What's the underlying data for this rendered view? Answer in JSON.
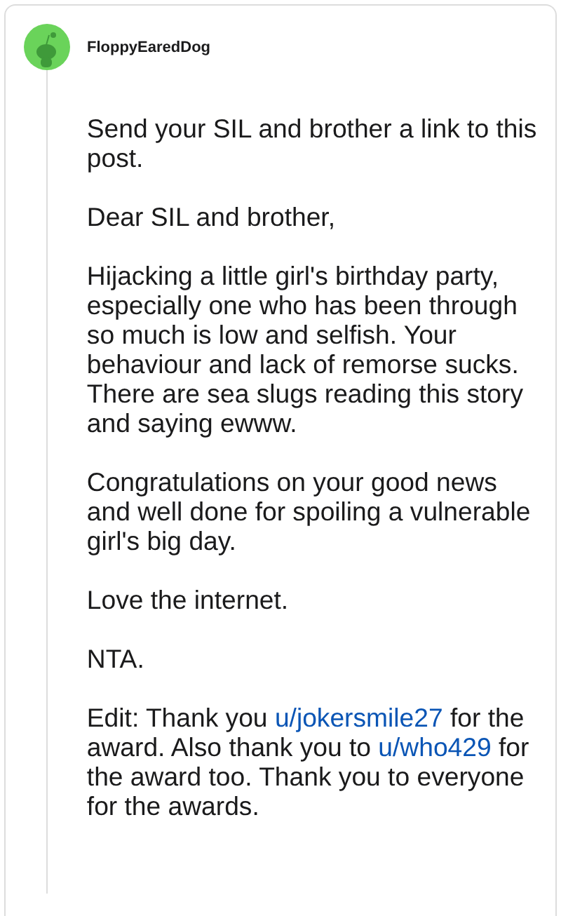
{
  "comment": {
    "author": "FloppyEaredDog",
    "paragraphs": [
      [
        {
          "kind": "text",
          "text": "Send your SIL and brother a link to this post."
        }
      ],
      [
        {
          "kind": "text",
          "text": "Dear SIL and brother,"
        }
      ],
      [
        {
          "kind": "text",
          "text": "Hijacking a little girl's birthday party, especially one who has been through so much is low and selfish. Your behaviour and lack of remorse sucks. There are sea slugs reading this story and saying ewww."
        }
      ],
      [
        {
          "kind": "text",
          "text": "Congratulations on your good news and well done for spoiling a vulnerable girl's big day."
        }
      ],
      [
        {
          "kind": "text",
          "text": "Love the internet."
        }
      ],
      [
        {
          "kind": "text",
          "text": "NTA."
        }
      ],
      [
        {
          "kind": "text",
          "text": "Edit: Thank you "
        },
        {
          "kind": "link",
          "text": "u/jokersmile27"
        },
        {
          "kind": "text",
          "text": " for the award. Also thank you to "
        },
        {
          "kind": "link",
          "text": "u/who429"
        },
        {
          "kind": "text",
          "text": " for the award too. Thank you to everyone for the awards."
        }
      ]
    ]
  }
}
